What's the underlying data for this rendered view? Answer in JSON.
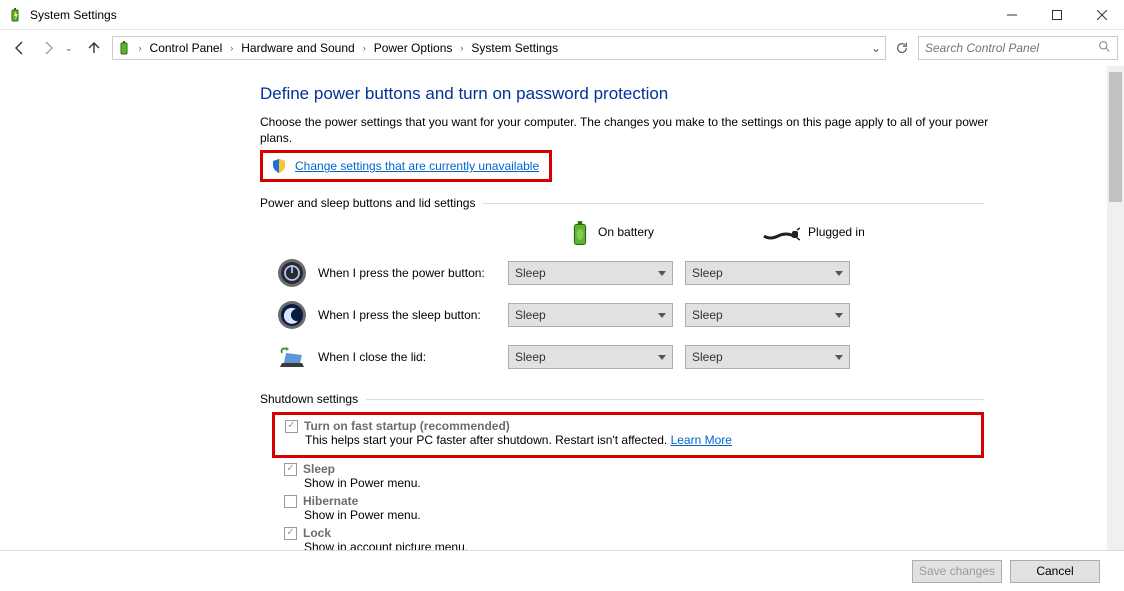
{
  "window": {
    "title": "System Settings"
  },
  "breadcrumb": {
    "items": [
      "Control Panel",
      "Hardware and Sound",
      "Power Options",
      "System Settings"
    ]
  },
  "search": {
    "placeholder": "Search Control Panel"
  },
  "main": {
    "heading": "Define power buttons and turn on password protection",
    "subtext": "Choose the power settings that you want for your computer. The changes you make to the settings on this page apply to all of your power plans.",
    "admin_link": "Change settings that are currently unavailable"
  },
  "group1": {
    "label": "Power and sleep buttons and lid settings",
    "cols": {
      "battery": "On battery",
      "plugged": "Plugged in"
    },
    "rows": {
      "power": {
        "label": "When I press the power button:",
        "battery": "Sleep",
        "plugged": "Sleep"
      },
      "sleep": {
        "label": "When I press the sleep button:",
        "battery": "Sleep",
        "plugged": "Sleep"
      },
      "lid": {
        "label": "When I close the lid:",
        "battery": "Sleep",
        "plugged": "Sleep"
      }
    }
  },
  "group2": {
    "label": "Shutdown settings",
    "fast": {
      "label": "Turn on fast startup (recommended)",
      "desc": "This helps start your PC faster after shutdown. Restart isn't affected. ",
      "learn": "Learn More"
    },
    "sleep": {
      "label": "Sleep",
      "desc": "Show in Power menu."
    },
    "hib": {
      "label": "Hibernate",
      "desc": "Show in Power menu."
    },
    "lock": {
      "label": "Lock",
      "desc": "Show in account picture menu."
    }
  },
  "footer": {
    "save": "Save changes",
    "cancel": "Cancel"
  }
}
